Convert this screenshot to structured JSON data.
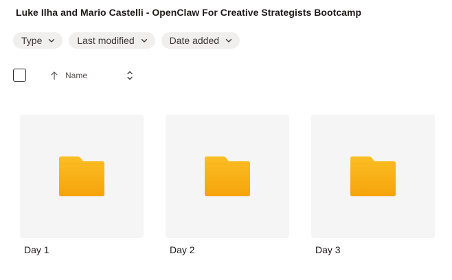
{
  "header": {
    "title": "Luke Ilha and Mario Castelli - OpenClaw For Creative Strategists Bootcamp"
  },
  "filters": [
    {
      "label": "Type",
      "icon": "chevron-down-icon"
    },
    {
      "label": "Last modified",
      "icon": "chevron-down-icon"
    },
    {
      "label": "Date added",
      "icon": "chevron-down-icon"
    }
  ],
  "toolbar": {
    "sort_label": "Name",
    "sort_icon": "arrow-up-icon",
    "toggle_icon": "chevron-up-down-icon"
  },
  "folders": [
    {
      "name": "Day 1",
      "icon": "folder-icon"
    },
    {
      "name": "Day 2",
      "icon": "folder-icon"
    },
    {
      "name": "Day 3",
      "icon": "folder-icon"
    }
  ],
  "colors": {
    "folder_top": "#fcbe24",
    "folder_bottom": "#f5a30b",
    "chip_bg": "#f0efed",
    "tile_bg": "#f5f5f5"
  }
}
